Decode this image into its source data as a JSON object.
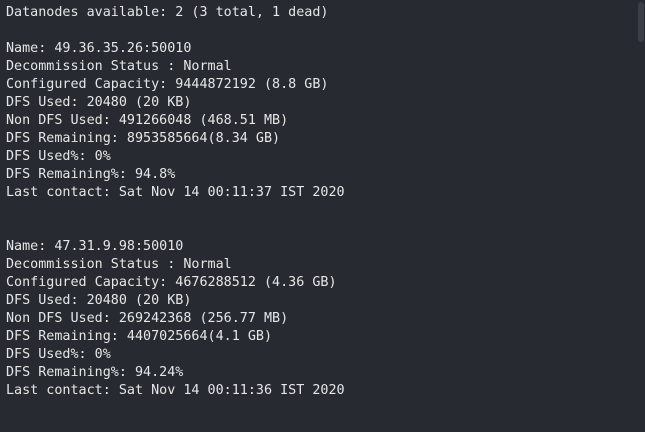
{
  "summary": "Datanodes available: 2 (3 total, 1 dead)",
  "nodes": [
    {
      "name": "Name: 49.36.35.26:50010",
      "decommission": "Decommission Status : Normal",
      "capacity": "Configured Capacity: 9444872192 (8.8 GB)",
      "dfs_used": "DFS Used: 20480 (20 KB)",
      "non_dfs_used": "Non DFS Used: 491266048 (468.51 MB)",
      "dfs_remaining": "DFS Remaining: 8953585664(8.34 GB)",
      "dfs_used_pct": "DFS Used%: 0%",
      "dfs_remaining_pct": "DFS Remaining%: 94.8%",
      "last_contact": "Last contact: Sat Nov 14 00:11:37 IST 2020"
    },
    {
      "name": "Name: 47.31.9.98:50010",
      "decommission": "Decommission Status : Normal",
      "capacity": "Configured Capacity: 4676288512 (4.36 GB)",
      "dfs_used": "DFS Used: 20480 (20 KB)",
      "non_dfs_used": "Non DFS Used: 269242368 (256.77 MB)",
      "dfs_remaining": "DFS Remaining: 4407025664(4.1 GB)",
      "dfs_used_pct": "DFS Used%: 0%",
      "dfs_remaining_pct": "DFS Remaining%: 94.24%",
      "last_contact": "Last contact: Sat Nov 14 00:11:36 IST 2020"
    }
  ]
}
